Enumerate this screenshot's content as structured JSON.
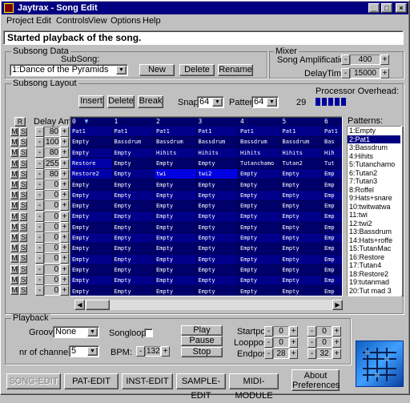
{
  "window": {
    "title": "Jaytrax - Song Edit"
  },
  "menu": [
    "Project",
    "Edit",
    "Controls",
    "View",
    "Options",
    "Help"
  ],
  "status": "Started playback of the song.",
  "subsong_data": {
    "group": "Subsong Data",
    "subsong_label": "SubSong:",
    "subsong_value": "1:Dance of the Pyramids",
    "new": "New",
    "delete": "Delete",
    "rename": "Rename"
  },
  "mixer": {
    "group": "Mixer",
    "amp_label": "Song Amplification:",
    "amp_value": "400",
    "delay_label": "DelayTime",
    "delay_value": "15000"
  },
  "layout": {
    "group": "Subsong Layout",
    "insert": "Insert",
    "delete": "Delete",
    "break": "Break",
    "snap_label": "Snap:",
    "snap_value": "64",
    "pattern_label": "Pattern:",
    "pattern_value": "64",
    "overhead_label": "Processor Overhead:",
    "overhead_value": "29",
    "delay_amt": "Delay Amt",
    "r": "R",
    "patterns_label": "Patterns:"
  },
  "tracks": [
    {
      "delay": "80",
      "cells": [
        "Pat1",
        "Pat1",
        "Pat1",
        "Pat1",
        "Pat1",
        "Pat1",
        "Pat1"
      ]
    },
    {
      "delay": "100",
      "cells": [
        "Empty",
        "Bassdrum",
        "Bassdrum",
        "Bassdrum",
        "Bassdrum",
        "Bassdrum",
        "Bas"
      ]
    },
    {
      "delay": "80",
      "cells": [
        "Empty",
        "Empty",
        "Hihits",
        "Hihits",
        "Hihits",
        "Hihits",
        "Hih"
      ]
    },
    {
      "delay": "255",
      "cells": [
        "Restore",
        "Empty",
        "Empty",
        "Empty",
        "Tutanchamo",
        "Tutan2",
        "Tut"
      ]
    },
    {
      "delay": "80",
      "cells": [
        "Restore2",
        "Empty",
        "twi",
        "twi2",
        "Empty",
        "Empty",
        "Emp"
      ]
    },
    {
      "delay": "0",
      "cells": [
        "Empty",
        "Empty",
        "Empty",
        "Empty",
        "Empty",
        "Empty",
        "Emp"
      ]
    },
    {
      "delay": "0",
      "cells": [
        "Empty",
        "Empty",
        "Empty",
        "Empty",
        "Empty",
        "Empty",
        "Emp"
      ]
    },
    {
      "delay": "0",
      "cells": [
        "Empty",
        "Empty",
        "Empty",
        "Empty",
        "Empty",
        "Empty",
        "Emp"
      ]
    },
    {
      "delay": "0",
      "cells": [
        "Empty",
        "Empty",
        "Empty",
        "Empty",
        "Empty",
        "Empty",
        "Emp"
      ]
    },
    {
      "delay": "0",
      "cells": [
        "Empty",
        "Empty",
        "Empty",
        "Empty",
        "Empty",
        "Empty",
        "Emp"
      ]
    },
    {
      "delay": "0",
      "cells": [
        "Empty",
        "Empty",
        "Empty",
        "Empty",
        "Empty",
        "Empty",
        "Emp"
      ]
    },
    {
      "delay": "0",
      "cells": [
        "Empty",
        "Empty",
        "Empty",
        "Empty",
        "Empty",
        "Empty",
        "Emp"
      ]
    },
    {
      "delay": "0",
      "cells": [
        "Empty",
        "Empty",
        "Empty",
        "Empty",
        "Empty",
        "Empty",
        "Emp"
      ]
    },
    {
      "delay": "0",
      "cells": [
        "Empty",
        "Empty",
        "Empty",
        "Empty",
        "Empty",
        "Empty",
        "Emp"
      ]
    },
    {
      "delay": "0",
      "cells": [
        "Empty",
        "Empty",
        "Empty",
        "Empty",
        "Empty",
        "Empty",
        "Emp"
      ]
    },
    {
      "delay": "0",
      "cells": [
        "Empty",
        "Empty",
        "Empty",
        "Empty",
        "Empty",
        "Empty",
        "Emp"
      ]
    }
  ],
  "columns": [
    "0",
    "1",
    "2",
    "3",
    "4",
    "5",
    "6"
  ],
  "patterns": [
    "1:Empty",
    "2:Pat1",
    "3:Bassdrum",
    "4:Hihits",
    "5:Tutanchamo",
    "6:Tutan2",
    "7:Tutan3",
    "8:Roffel",
    "9:Hats+snare",
    "10:twitwatwa",
    "11:twi",
    "12:twi2",
    "13:Bassdrum",
    "14:Hats+roffe",
    "15:TutanMac",
    "16:Restore",
    "17:Tutan4",
    "18:Restore2",
    "19:tutanmad",
    "20:Tut mad 3"
  ],
  "playback": {
    "group": "Playback",
    "groove_label": "Groove:",
    "groove_value": "None",
    "songloop_label": "Songloop",
    "channels_label": "nr of channels:",
    "channels_value": "5",
    "bpm_label": "BPM:",
    "bpm_value": "132",
    "play": "Play",
    "pause": "Pause",
    "stop": "Stop",
    "startpos_label": "Startpos:",
    "looppos_label": "Looppos:",
    "endpos_label": "Endpos:",
    "startpos": [
      "0",
      "0"
    ],
    "looppos": [
      "0",
      "0"
    ],
    "endpos": [
      "28",
      "32"
    ]
  },
  "bottom": {
    "song_edit": "SONG-EDIT",
    "pat_edit": "PAT-EDIT",
    "inst_edit": "INST-EDIT",
    "sample_edit": "SAMPLE-EDIT",
    "midi": "MIDI-MODULE",
    "about": "About",
    "prefs": "Preferences"
  },
  "colors": {
    "title_bar": "#000080",
    "grid_bg": "#00006b",
    "row_highlight": "#0000e0"
  }
}
